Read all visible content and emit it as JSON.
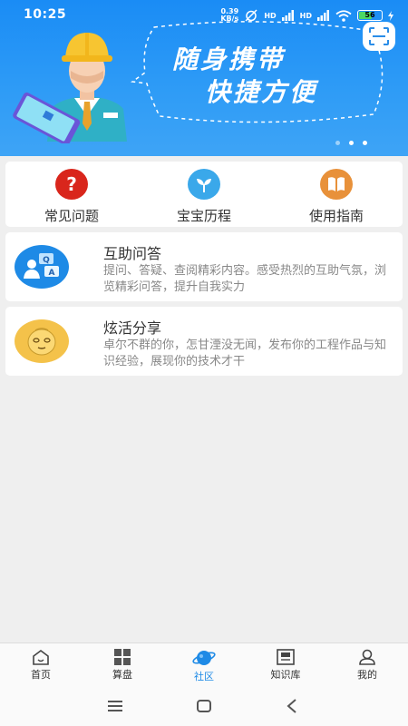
{
  "status_bar": {
    "time": "10:25",
    "speed_value": "0.39",
    "speed_unit": "KB/s",
    "signal1": "HD",
    "signal2": "HD",
    "battery": "56"
  },
  "banner": {
    "slogan_line1": "随身携带",
    "slogan_line2": "快捷方便",
    "pages": 3,
    "active_page": 1
  },
  "quick_nav": [
    {
      "label": "常见问题",
      "icon": "question-icon",
      "color": "#d9261c"
    },
    {
      "label": "宝宝历程",
      "icon": "sprout-icon",
      "color": "#3aa8ea"
    },
    {
      "label": "使用指南",
      "icon": "book-icon",
      "color": "#e8913a"
    }
  ],
  "features": [
    {
      "title": "互助问答",
      "desc": "提问、答疑、查阅精彩内容。感受热烈的互助气氛，浏览精彩问答，提升自我实力",
      "icon": "qa-icon",
      "color": "#1e8ae6"
    },
    {
      "title": "炫活分享",
      "desc": "卓尔不群的你，怎甘湮没无闻，发布你的工程作品与知识经验，展现你的技术才干",
      "icon": "smiley-face-icon",
      "color": "#f4c24a"
    }
  ],
  "tabbar": {
    "items": [
      {
        "label": "首页",
        "icon": "home-icon"
      },
      {
        "label": "算盘",
        "icon": "grid-icon"
      },
      {
        "label": "社区",
        "icon": "planet-icon"
      },
      {
        "label": "知识库",
        "icon": "library-icon"
      },
      {
        "label": "我的",
        "icon": "user-icon"
      }
    ],
    "active": "社区",
    "active_color": "#1e8ae6"
  }
}
